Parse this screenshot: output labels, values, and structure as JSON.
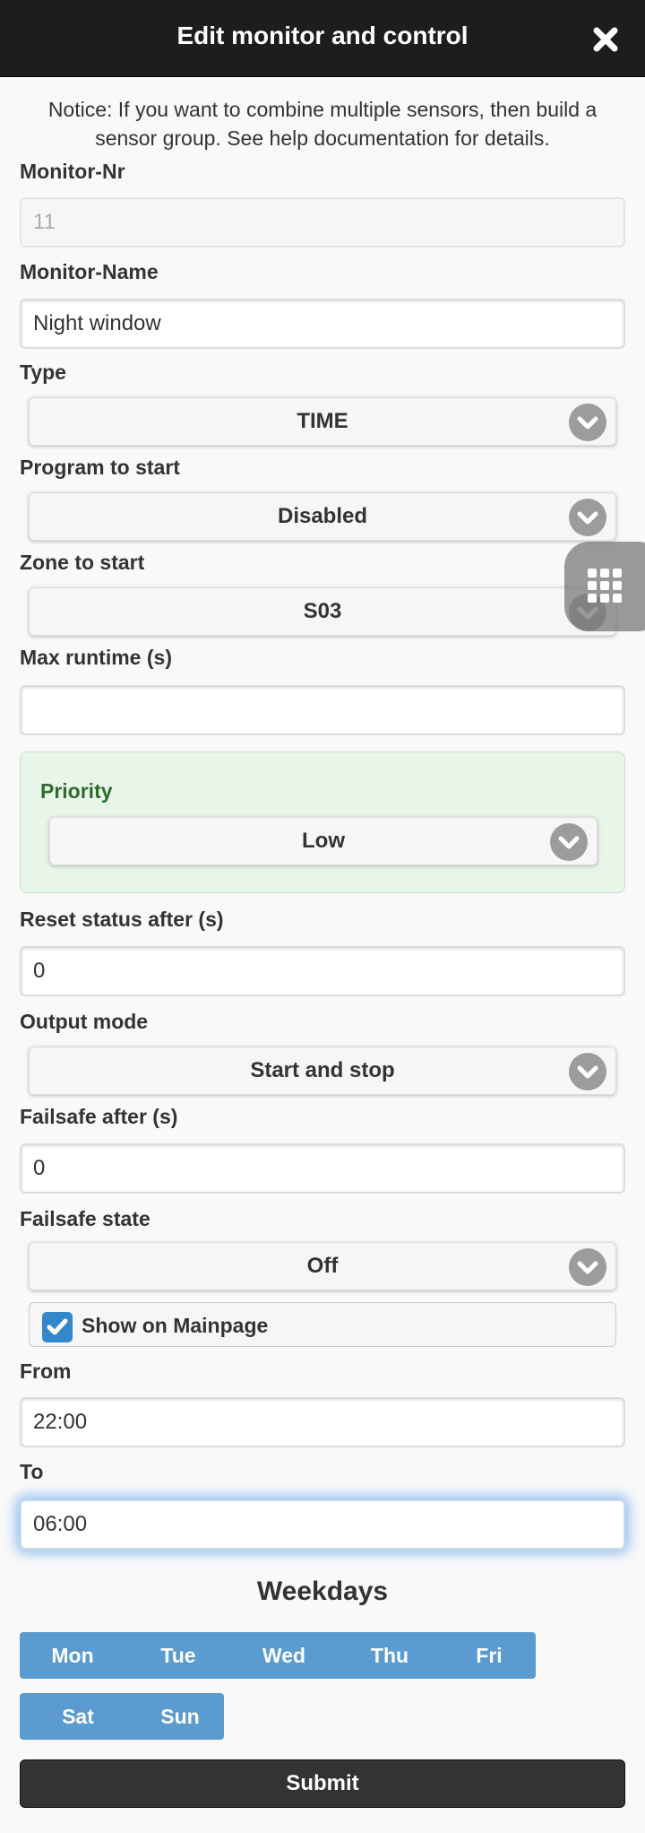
{
  "dialog": {
    "title": "Edit monitor and control",
    "notice": "Notice: If you want to combine multiple sensors, then build a sensor group. See help documentation for details."
  },
  "fields": {
    "monitor_nr": {
      "label": "Monitor-Nr",
      "value": "11"
    },
    "monitor_name": {
      "label": "Monitor-Name",
      "value": "Night window"
    },
    "type": {
      "label": "Type",
      "value": "TIME"
    },
    "program": {
      "label": "Program to start",
      "value": "Disabled"
    },
    "zone": {
      "label": "Zone to start",
      "value": "S03"
    },
    "max_runtime": {
      "label": "Max runtime (s)",
      "value": ""
    },
    "priority": {
      "label": "Priority",
      "value": "Low"
    },
    "reset_status": {
      "label": "Reset status after (s)",
      "value": "0"
    },
    "output_mode": {
      "label": "Output mode",
      "value": "Start and stop"
    },
    "failsafe_after": {
      "label": "Failsafe after (s)",
      "value": "0"
    },
    "failsafe_state": {
      "label": "Failsafe state",
      "value": "Off"
    },
    "show_on_mainpage": {
      "label": "Show on Mainpage",
      "checked": true
    },
    "from": {
      "label": "From",
      "value": "22:00"
    },
    "to": {
      "label": "To",
      "value": "06:00"
    }
  },
  "weekdays": {
    "title": "Weekdays",
    "days": [
      "Mon",
      "Tue",
      "Wed",
      "Thu",
      "Fri",
      "Sat",
      "Sun"
    ]
  },
  "submit_label": "Submit",
  "colors": {
    "header_bg": "#1d1d1d",
    "accent_blue": "#3388cc",
    "day_button_blue": "#5b9bd0",
    "priority_bg": "#e8f5e9",
    "priority_text": "#2f6b2f"
  },
  "icons": {
    "close": "close-icon",
    "chevron": "chevron-down-icon",
    "check": "checkmark-icon",
    "floating": "grid-icon"
  }
}
